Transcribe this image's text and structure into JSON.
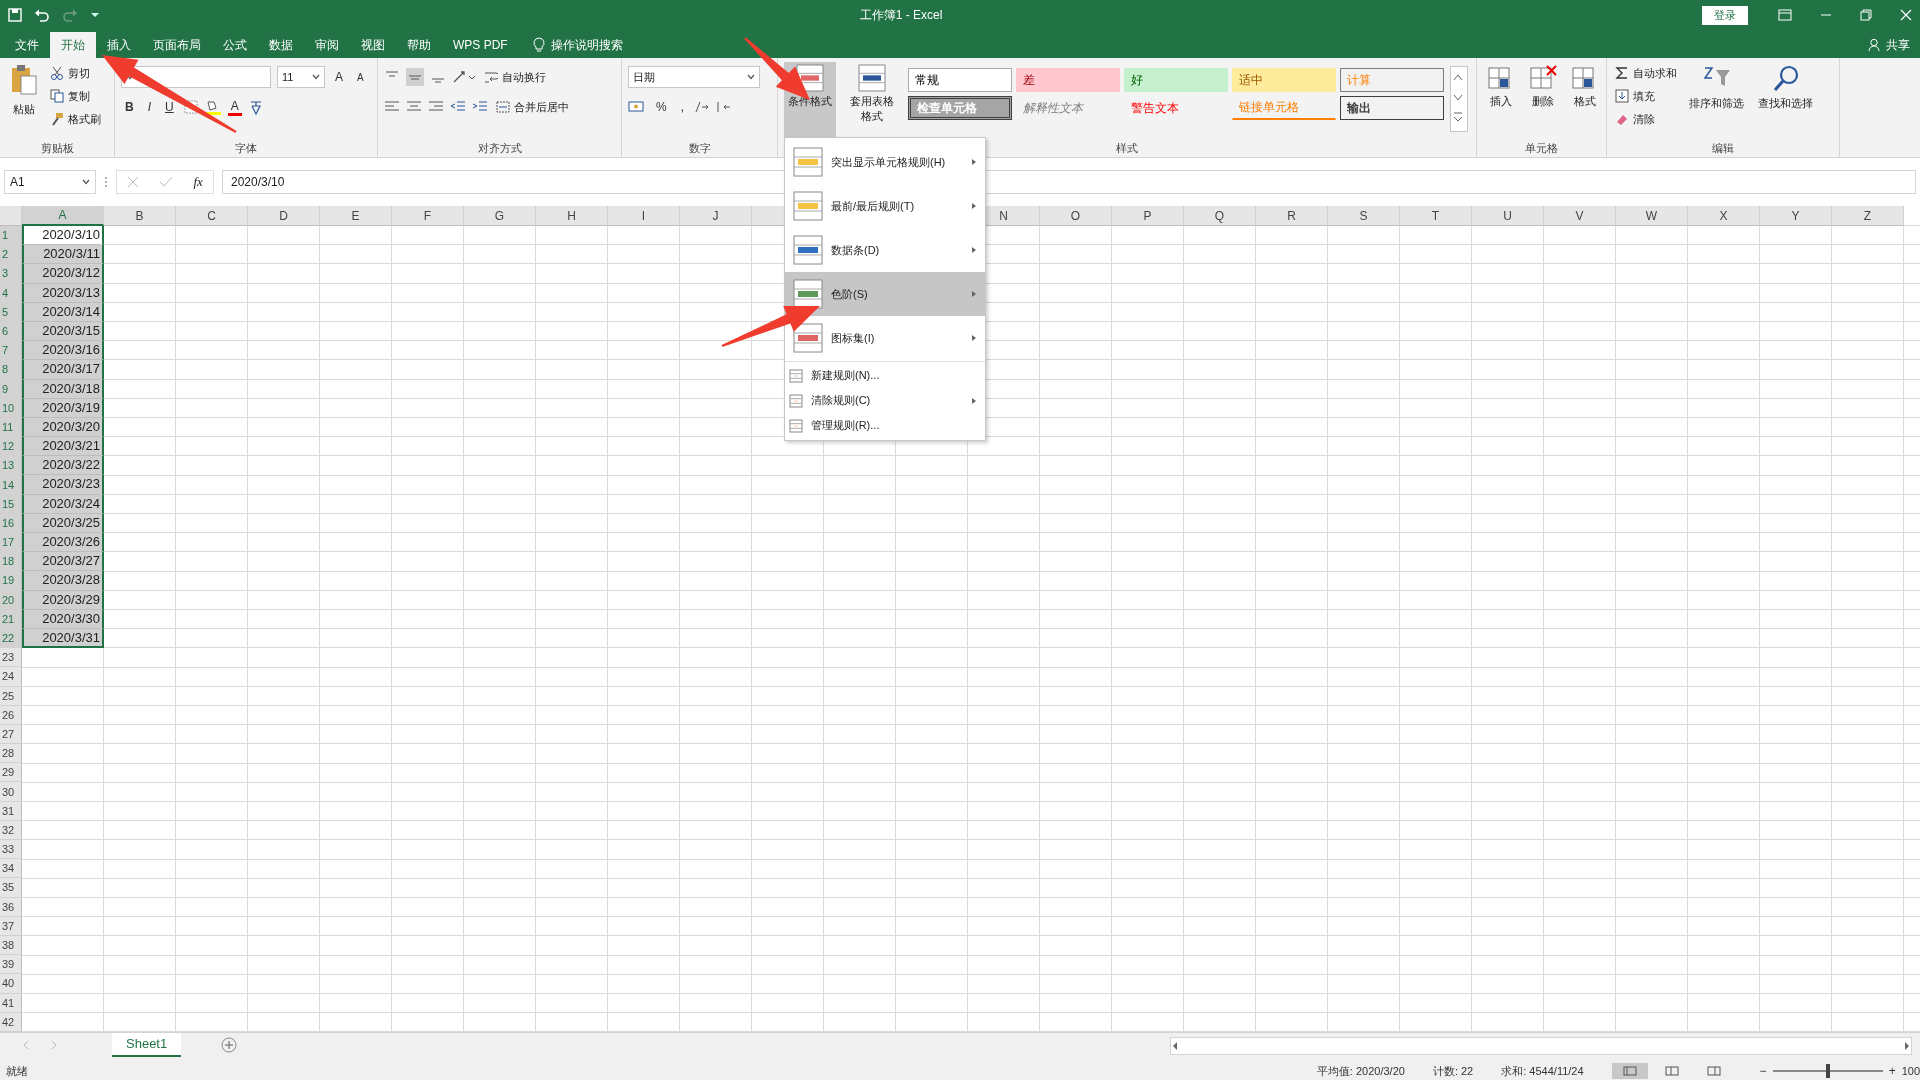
{
  "window": {
    "title": "工作簿1 - Excel",
    "sign_in": "登录"
  },
  "tabs": [
    {
      "label": "文件",
      "selected": false
    },
    {
      "label": "开始",
      "selected": true
    },
    {
      "label": "插入",
      "selected": false
    },
    {
      "label": "页面布局",
      "selected": false
    },
    {
      "label": "公式",
      "selected": false
    },
    {
      "label": "数据",
      "selected": false
    },
    {
      "label": "审阅",
      "selected": false
    },
    {
      "label": "视图",
      "selected": false
    },
    {
      "label": "帮助",
      "selected": false
    },
    {
      "label": "WPS PDF",
      "selected": false
    }
  ],
  "tell_me": "操作说明搜索",
  "share": "共享",
  "clipboard": {
    "paste": "粘贴",
    "cut": "剪切",
    "copy": "复制",
    "format_painter": "格式刷",
    "label": "剪贴板"
  },
  "font": {
    "size": "11",
    "grow": "A",
    "shrink": "A",
    "bold": "B",
    "italic": "I",
    "underline": "U",
    "font_color": "A",
    "label": "字体"
  },
  "alignment": {
    "wrap": "自动换行",
    "merge": "合并后居中",
    "label": "对齐方式"
  },
  "number": {
    "format": "日期",
    "percent": "%",
    "comma": ",",
    "label": "数字"
  },
  "styles": {
    "conditional_formatting": {
      "label": "条件格式",
      "selected": true
    },
    "format_as_table": "套用表格格式",
    "label": "样式",
    "gallery": [
      {
        "text": "常规",
        "kind": "normal"
      },
      {
        "text": "差",
        "kind": "bad"
      },
      {
        "text": "好",
        "kind": "good"
      },
      {
        "text": "适中",
        "kind": "neutral"
      },
      {
        "text": "计算",
        "kind": "calculation"
      },
      {
        "text": "检查单元格",
        "kind": "check"
      },
      {
        "text": "解释性文本",
        "kind": "explanatory"
      },
      {
        "text": "警告文本",
        "kind": "warning"
      },
      {
        "text": "链接单元格",
        "kind": "linked"
      },
      {
        "text": "输出",
        "kind": "output"
      }
    ]
  },
  "cells_group": {
    "buttons": [
      "插入",
      "删除",
      "格式"
    ],
    "label": "单元格"
  },
  "editing": {
    "autosum": "自动求和",
    "fill": "填充",
    "clear": "清除",
    "sort_filter": "排序和筛选",
    "find_select": "查找和选择",
    "label": "编辑"
  },
  "formula_bar": {
    "name_box": "A1",
    "fx": "fx",
    "formula": "2020/3/10"
  },
  "columns": [
    {
      "label": "A",
      "selected": true
    },
    {
      "label": "B",
      "selected": false
    },
    {
      "label": "C",
      "selected": false
    },
    {
      "label": "D",
      "selected": false
    },
    {
      "label": "E",
      "selected": false
    },
    {
      "label": "F",
      "selected": false
    },
    {
      "label": "G",
      "selected": false
    },
    {
      "label": "H",
      "selected": false
    },
    {
      "label": "I",
      "selected": false
    },
    {
      "label": "J",
      "selected": false
    },
    {
      "selected": false
    },
    null,
    null,
    {
      "label": "N",
      "selected": false
    },
    {
      "label": "O",
      "selected": false
    },
    {
      "label": "P",
      "selected": false
    },
    {
      "label": "Q",
      "selected": false
    },
    {
      "label": "R",
      "selected": false
    },
    {
      "label": "S",
      "selected": false
    },
    {
      "label": "T",
      "selected": false
    },
    {
      "label": "U",
      "selected": false
    },
    {
      "label": "V",
      "selected": false
    },
    {
      "label": "W",
      "selected": false
    },
    {
      "label": "X",
      "selected": false
    },
    {
      "label": "Y",
      "selected": false
    },
    {
      "label": "Z",
      "selected": false
    }
  ],
  "rows": [
    {
      "label": "1",
      "selected": true
    },
    {
      "label": "2",
      "selected": true
    },
    {
      "label": "3",
      "selected": true
    },
    {
      "label": "4",
      "selected": true
    },
    {
      "label": "5",
      "selected": true
    },
    {
      "label": "6",
      "selected": true
    },
    {
      "label": "7",
      "selected": true
    },
    {
      "label": "8",
      "selected": true
    },
    {
      "label": "9",
      "selected": true
    },
    {
      "label": "10",
      "selected": true
    },
    {
      "label": "11",
      "selected": true
    },
    {
      "label": "12",
      "selected": true
    },
    {
      "label": "13",
      "selected": true
    },
    {
      "label": "14",
      "selected": true
    },
    {
      "label": "15",
      "selected": true
    },
    {
      "label": "16",
      "selected": true
    },
    {
      "label": "17",
      "selected": true
    },
    {
      "label": "18",
      "selected": true
    },
    {
      "label": "19",
      "selected": true
    },
    {
      "label": "20",
      "selected": true
    },
    {
      "label": "21",
      "selected": true
    },
    {
      "label": "22",
      "selected": true
    },
    {
      "label": "23",
      "selected": false
    },
    {
      "label": "24",
      "selected": false
    },
    {
      "label": "25",
      "selected": false
    },
    {
      "label": "26",
      "selected": false
    },
    {
      "label": "27",
      "selected": false
    },
    {
      "label": "28",
      "selected": false
    },
    {
      "label": "29",
      "selected": false
    },
    {
      "label": "30",
      "selected": false
    },
    {
      "label": "31",
      "selected": false
    },
    {
      "label": "32",
      "selected": false
    },
    {
      "label": "33",
      "selected": false
    },
    {
      "label": "34",
      "selected": false
    },
    {
      "label": "35",
      "selected": false
    },
    {
      "label": "36",
      "selected": false
    },
    {
      "label": "37",
      "selected": false
    },
    {
      "label": "38",
      "selected": false
    },
    {
      "label": "39",
      "selected": false
    },
    {
      "label": "40",
      "selected": false
    },
    {
      "label": "41",
      "selected": false
    },
    {
      "label": "42",
      "selected": false
    }
  ],
  "column_a": [
    {
      "value": "2020/3/10",
      "active": true
    },
    {
      "value": "2020/3/11",
      "active": false
    },
    {
      "value": "2020/3/12",
      "active": false
    },
    {
      "value": "2020/3/13",
      "active": false
    },
    {
      "value": "2020/3/14",
      "active": false
    },
    {
      "value": "2020/3/15",
      "active": false
    },
    {
      "value": "2020/3/16",
      "active": false
    },
    {
      "value": "2020/3/17",
      "active": false
    },
    {
      "value": "2020/3/18",
      "active": false
    },
    {
      "value": "2020/3/19",
      "active": false
    },
    {
      "value": "2020/3/20",
      "active": false
    },
    {
      "value": "2020/3/21",
      "active": false
    },
    {
      "value": "2020/3/22",
      "active": false
    },
    {
      "value": "2020/3/23",
      "active": false
    },
    {
      "value": "2020/3/24",
      "active": false
    },
    {
      "value": "2020/3/25",
      "active": false
    },
    {
      "value": "2020/3/26",
      "active": false
    },
    {
      "value": "2020/3/27",
      "active": false
    },
    {
      "value": "2020/3/28",
      "active": false
    },
    {
      "value": "2020/3/29",
      "active": false
    },
    {
      "value": "2020/3/30",
      "active": false
    },
    {
      "value": "2020/3/31",
      "active": false
    }
  ],
  "menu": [
    {
      "label": "突出显示单元格规则(H)",
      "kind": "rule-set",
      "submenu": true,
      "selected": false
    },
    {
      "label": "最前/最后规则(T)",
      "kind": "rule-set",
      "submenu": true,
      "selected": false
    },
    {
      "label": "数据条(D)",
      "kind": "rule-set",
      "submenu": true,
      "selected": false
    },
    {
      "label": "色阶(S)",
      "kind": "rule-set",
      "submenu": true,
      "selected": true
    },
    {
      "label": "图标集(I)",
      "kind": "rule-set",
      "submenu": true,
      "selected": false
    },
    {
      "label": "新建规则(N)...",
      "kind": "command",
      "submenu": false,
      "selected": false
    },
    {
      "label": "清除规则(C)",
      "kind": "command",
      "submenu": true,
      "selected": false
    },
    {
      "label": "管理规则(R)...",
      "kind": "command",
      "submenu": false,
      "selected": false
    }
  ],
  "sheets": [
    {
      "label": "Sheet1",
      "selected": true
    }
  ],
  "status_bar": {
    "ready": "就绪",
    "average": "平均值: 2020/3/20",
    "count": "计数: 22",
    "sum": "求和: 4544/11/24",
    "views": [
      {
        "selected": true
      },
      {
        "selected": false
      },
      {
        "selected": false
      }
    ],
    "zoom": {
      "out": "−",
      "in": "+",
      "level": 0.5,
      "reading": "100"
    }
  }
}
